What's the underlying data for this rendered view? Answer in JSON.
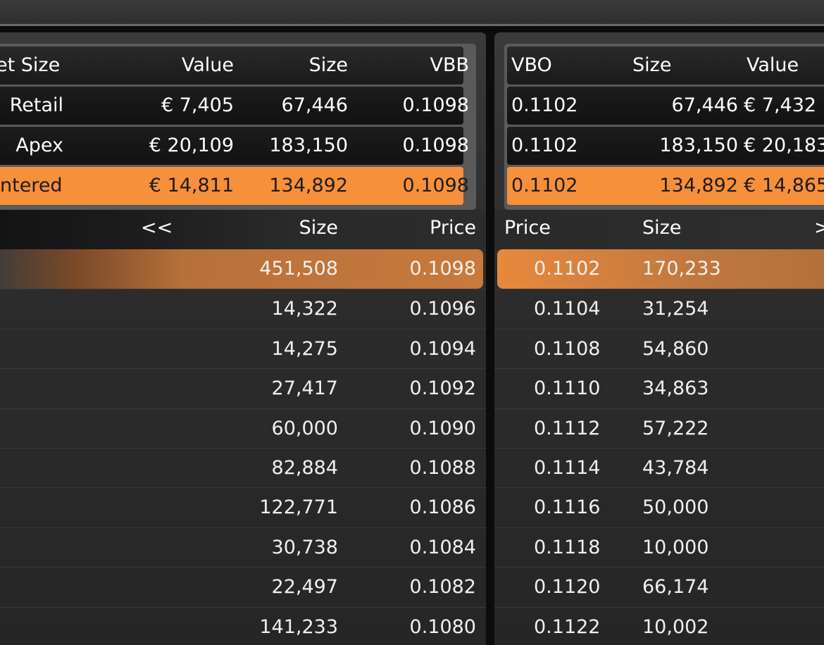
{
  "summary_bid": {
    "headers": [
      "et Size",
      "Value",
      "Size",
      "VBB"
    ],
    "rows": [
      {
        "label": "Retail",
        "value": "€ 7,405",
        "size": "67,446",
        "vbb": "0.1098"
      },
      {
        "label": "Apex",
        "value": "€ 20,109",
        "size": "183,150",
        "vbb": "0.1098"
      },
      {
        "label": "ntered",
        "value": "€ 14,811",
        "size": "134,892",
        "vbb": "0.1098"
      }
    ]
  },
  "summary_ask": {
    "headers": [
      "VBO",
      "Size",
      "Value"
    ],
    "rows": [
      {
        "vbo": "0.1102",
        "size": "67,446",
        "value": "€ 7,432"
      },
      {
        "vbo": "0.1102",
        "size": "183,150",
        "value": "€ 20,183"
      },
      {
        "vbo": "0.1102",
        "size": "134,892",
        "value": "€ 14,865"
      }
    ]
  },
  "orderbook_bid": {
    "nav_label": "<<",
    "headers": [
      "Size",
      "Price"
    ],
    "rows": [
      {
        "size": "451,508",
        "price": "0.1098"
      },
      {
        "size": "14,322",
        "price": "0.1096"
      },
      {
        "size": "14,275",
        "price": "0.1094"
      },
      {
        "size": "27,417",
        "price": "0.1092"
      },
      {
        "size": "60,000",
        "price": "0.1090"
      },
      {
        "size": "82,884",
        "price": "0.1088"
      },
      {
        "size": "122,771",
        "price": "0.1086"
      },
      {
        "size": "30,738",
        "price": "0.1084"
      },
      {
        "size": "22,497",
        "price": "0.1082"
      },
      {
        "size": "141,233",
        "price": "0.1080"
      }
    ]
  },
  "orderbook_ask": {
    "nav_label": ">",
    "headers": [
      "Price",
      "Size"
    ],
    "rows": [
      {
        "price": "0.1102",
        "size": "170,233"
      },
      {
        "price": "0.1104",
        "size": "31,254"
      },
      {
        "price": "0.1108",
        "size": "54,860"
      },
      {
        "price": "0.1110",
        "size": "34,863"
      },
      {
        "price": "0.1112",
        "size": "57,222"
      },
      {
        "price": "0.1114",
        "size": "43,784"
      },
      {
        "price": "0.1116",
        "size": "50,000"
      },
      {
        "price": "0.1118",
        "size": "10,000"
      },
      {
        "price": "0.1120",
        "size": "66,174"
      },
      {
        "price": "0.1122",
        "size": "10,002"
      }
    ]
  },
  "colors": {
    "accent": "#f7903a",
    "background": "#141414",
    "text": "#ffffff"
  }
}
